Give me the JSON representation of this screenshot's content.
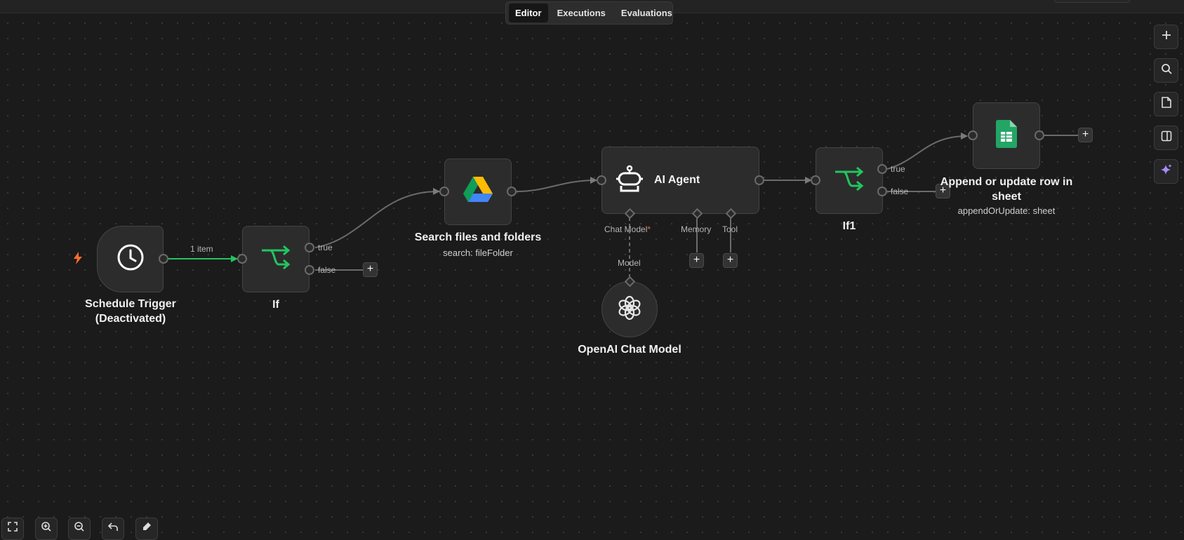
{
  "header": {
    "tabs": [
      {
        "label": "Editor",
        "active": true
      },
      {
        "label": "Executions",
        "active": false
      },
      {
        "label": "Evaluations",
        "active": false
      }
    ]
  },
  "colors": {
    "canvas": "#1b1b1b",
    "node": "#2c2c2c",
    "success_edge": "#22c55e",
    "edge": "#6b6b6b",
    "trigger_bolt": "#ff6d2d",
    "ai_sparkle": "#a78bfa",
    "required": "#ff5a5a"
  },
  "nodes": {
    "schedule_trigger": {
      "label_line1": "Schedule Trigger",
      "label_line2": "(Deactivated)",
      "icon": "clock-icon"
    },
    "if": {
      "label": "If",
      "icon": "branch-icon",
      "output_true": "true",
      "output_false": "false"
    },
    "search": {
      "label": "Search files and folders",
      "subtitle": "search: fileFolder",
      "icon": "google-drive-icon"
    },
    "ai_agent": {
      "label": "AI Agent",
      "icon": "robot-icon",
      "sub_inputs": {
        "chat_model": "Chat Model",
        "chat_model_required": "*",
        "memory": "Memory",
        "tool": "Tool"
      }
    },
    "openai": {
      "label": "OpenAI Chat Model",
      "icon": "openai-icon",
      "port_label": "Model"
    },
    "if1": {
      "label": "If1",
      "icon": "branch-icon",
      "output_true": "true",
      "output_false": "false"
    },
    "sheets": {
      "label_line1": "Append or update row in",
      "label_line2": "sheet",
      "subtitle": "appendOrUpdate: sheet",
      "icon": "google-sheets-icon"
    }
  },
  "edges": {
    "trigger_to_if_label": "1 item"
  },
  "side_toolbar": [
    "plus-icon",
    "search-icon",
    "sticky-note-icon",
    "panel-icon",
    "ai-sparkle-icon"
  ],
  "bottom_toolbar": [
    "fit-view-icon",
    "zoom-in-icon",
    "zoom-out-icon",
    "undo-icon",
    "clean-up-icon"
  ]
}
